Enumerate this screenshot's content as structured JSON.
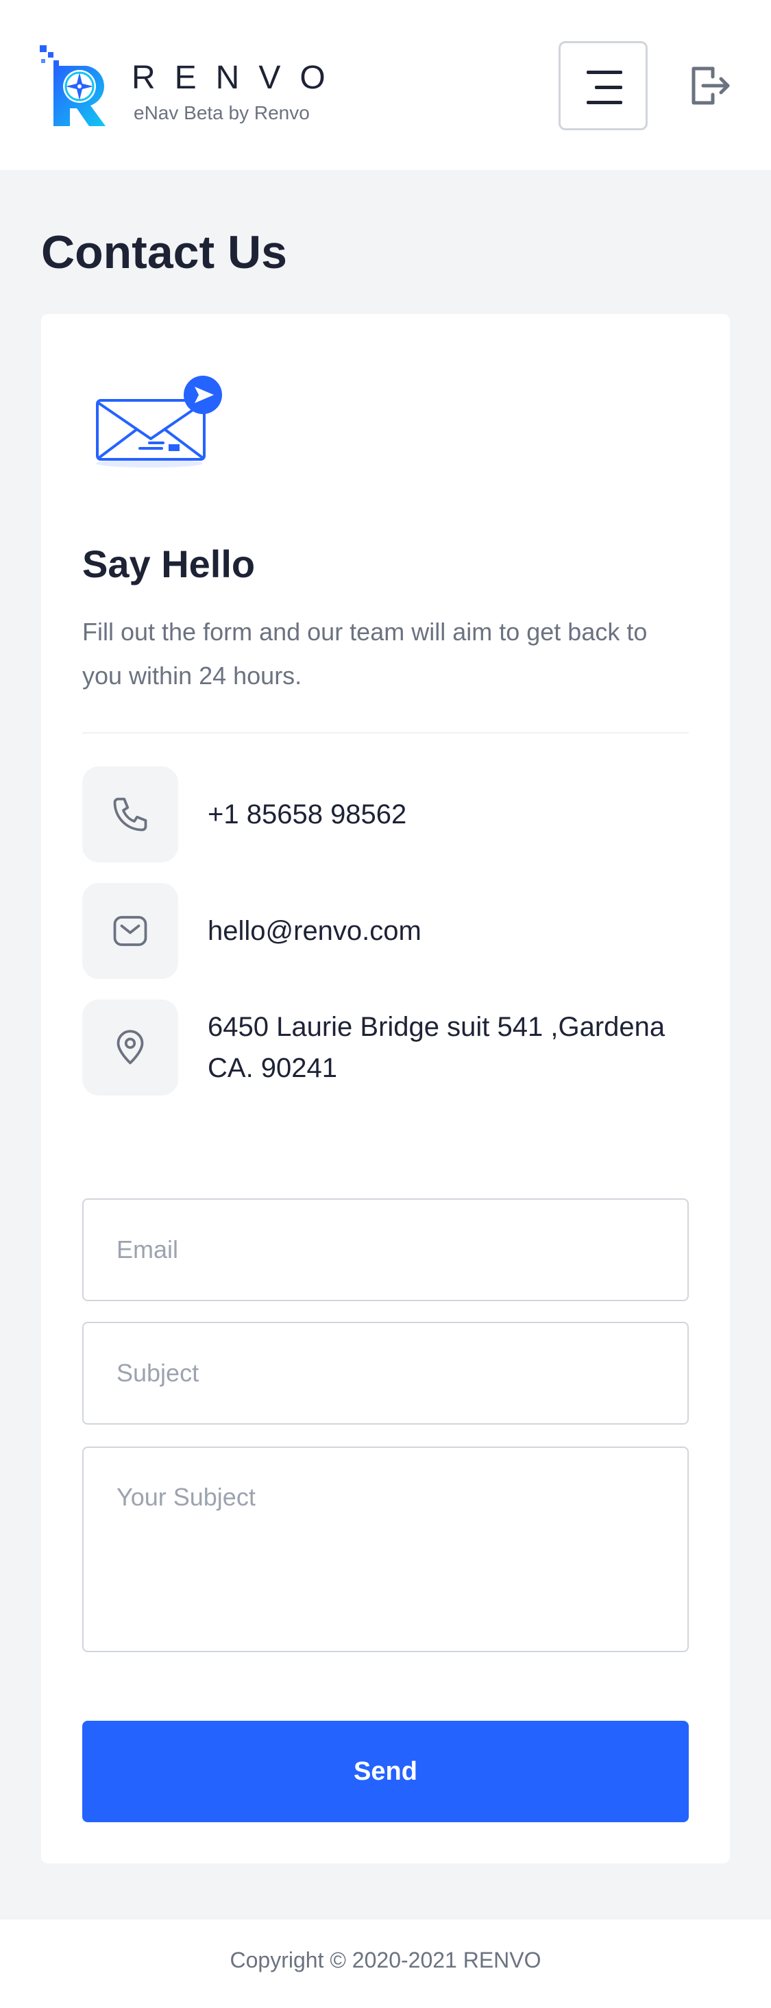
{
  "header": {
    "brand_name": "RENVO",
    "brand_tagline": "eNav Beta by Renvo",
    "logo_icon": "compass-r-logo",
    "menu_icon": "hamburger-menu-icon",
    "logout_icon": "logout-icon"
  },
  "page": {
    "title": "Contact Us"
  },
  "contact_card": {
    "illustration_icon": "envelope-send-icon",
    "heading": "Say Hello",
    "intro": "Fill out the form and our team will aim to get back to you within 24 hours.",
    "items": [
      {
        "icon": "phone-icon",
        "text": "+1 85658 98562"
      },
      {
        "icon": "mail-icon",
        "text": "hello@renvo.com"
      },
      {
        "icon": "location-pin-icon",
        "text": "6450 Laurie Bridge suit 541 ,Gardena CA. 90241"
      }
    ]
  },
  "form": {
    "email_placeholder": "Email",
    "subject_placeholder": "Subject",
    "message_placeholder": "Your Subject",
    "send_label": "Send"
  },
  "footer": {
    "copyright": "Copyright © 2020-2021 RENVO"
  },
  "colors": {
    "accent": "#2563ff",
    "text_dark": "#1e2235",
    "text_muted": "#6b7280",
    "page_bg": "#f3f4f6"
  }
}
